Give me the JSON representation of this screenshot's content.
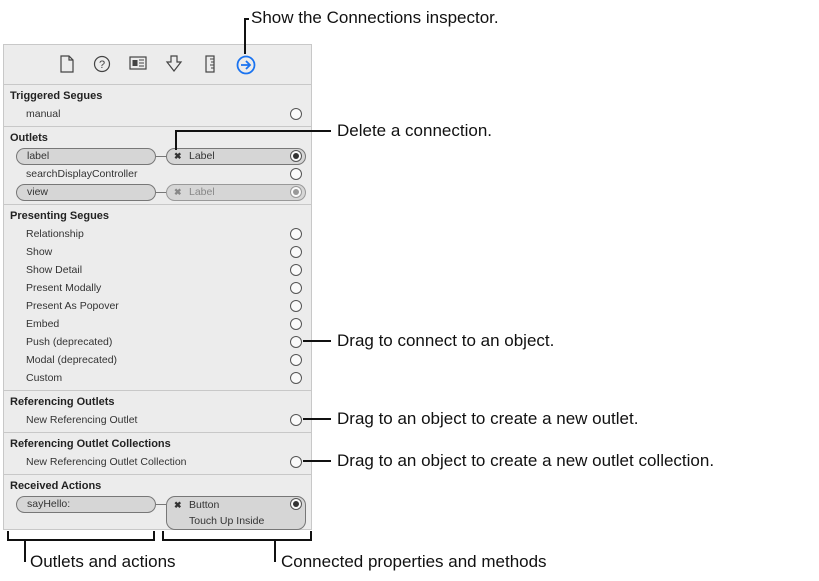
{
  "toolbar": {
    "icons": [
      "file-icon",
      "help-icon",
      "identity-icon",
      "attributes-icon",
      "size-icon",
      "connections-icon"
    ],
    "accent": "#1a73f0"
  },
  "sections": {
    "triggered": {
      "title": "Triggered Segues",
      "items": [
        "manual"
      ]
    },
    "outlets": {
      "title": "Outlets",
      "label": {
        "name": "label",
        "target": "Label"
      },
      "search": "searchDisplayController",
      "view": {
        "name": "view",
        "target": "Label"
      }
    },
    "presenting": {
      "title": "Presenting Segues",
      "items": [
        "Relationship",
        "Show",
        "Show Detail",
        "Present Modally",
        "Present As Popover",
        "Embed",
        "Push (deprecated)",
        "Modal (deprecated)",
        "Custom"
      ]
    },
    "ref_outlets": {
      "title": "Referencing Outlets",
      "items": [
        "New Referencing Outlet"
      ]
    },
    "ref_collections": {
      "title": "Referencing Outlet Collections",
      "items": [
        "New Referencing Outlet Collection"
      ]
    },
    "actions": {
      "title": "Received Actions",
      "name": "sayHello:",
      "target": "Button",
      "event": "Touch Up Inside"
    }
  },
  "callouts": {
    "show": "Show the Connections inspector.",
    "delete": "Delete a connection.",
    "drag_connect": "Drag to connect to an object.",
    "drag_outlet": "Drag to an object to create a new outlet.",
    "drag_collection": "Drag to an object to create a new outlet collection.",
    "outlets_actions": "Outlets and actions",
    "connected": "Connected properties and methods"
  },
  "delete_glyph": "✖"
}
